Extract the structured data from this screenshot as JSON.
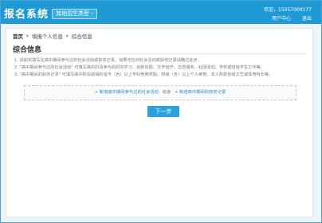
{
  "header": {
    "app_title": "报名系统",
    "switch_label": "其他招生类型",
    "welcome_text": "欢迎，15057009177",
    "user_center": "用户中心",
    "logout": "退出"
  },
  "breadcrumb": [
    "首页",
    "填报个人信息",
    "综合信息"
  ],
  "section_title": "综合信息",
  "notes": [
    "1.  请如实填写在高中期间参与过的社会活动或获奖记录，如果无任何社会活动或获奖记录请略过此步。",
    "2.  \"高中期间参与过的社会活动\" 可填写高中阶段参与的研究学习、创新实践、文学创作、志愿服务、社团活动、学校或班级学生工作等。",
    "3.  \"高中期间的获奖记录\" 可填写高中阶段获得的省市（含）以上学科竞赛奖励、校级（含）以上个人荣誉、本人所获省级文艺或体育特长等。"
  ],
  "actions": {
    "add_activity": "+ 新增高中期间参与过的社会活动",
    "or": "或者",
    "add_award": "+ 新增高中期间的获奖记录"
  },
  "next_button": "下一步"
}
